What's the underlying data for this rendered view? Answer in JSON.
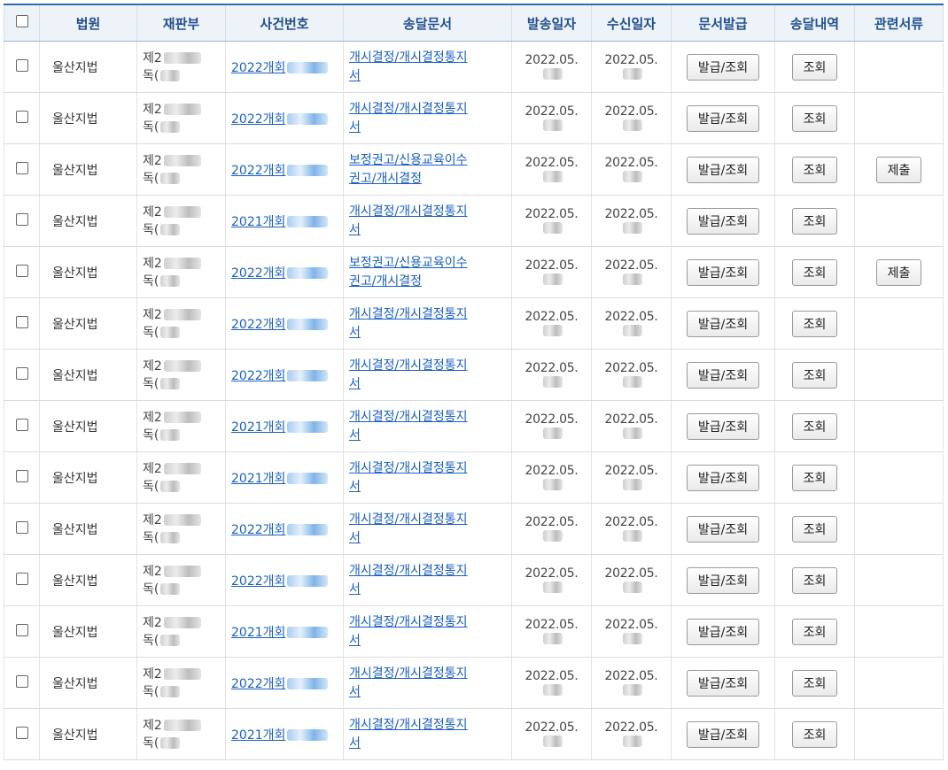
{
  "header": {
    "col_court": "법원",
    "col_dept": "재판부",
    "col_case": "사건번호",
    "col_doc": "송달문서",
    "col_sent": "발송일자",
    "col_recv": "수신일자",
    "col_issue": "문서발급",
    "col_delivery": "송달내역",
    "col_related": "관련서류"
  },
  "rows": [
    {
      "court": "울산지법",
      "dept1": "제2",
      "dept2": "독(",
      "case": "2022개회",
      "doc1": "개시결정/개시결정통지",
      "doc2": "서",
      "sent": "2022.05.",
      "recv": "2022.05.",
      "issue": "발급/조회",
      "delivery": "조회",
      "related": ""
    },
    {
      "court": "울산지법",
      "dept1": "제2",
      "dept2": "독(",
      "case": "2022개회",
      "doc1": "개시결정/개시결정통지",
      "doc2": "서",
      "sent": "2022.05.",
      "recv": "2022.05.",
      "issue": "발급/조회",
      "delivery": "조회",
      "related": ""
    },
    {
      "court": "울산지법",
      "dept1": "제2",
      "dept2": "독(",
      "case": "2022개회",
      "doc1": "보정권고/신용교육이수",
      "doc2": "권고/개시결정",
      "sent": "2022.05.",
      "recv": "2022.05.",
      "issue": "발급/조회",
      "delivery": "조회",
      "related": "제출"
    },
    {
      "court": "울산지법",
      "dept1": "제2",
      "dept2": "독(",
      "case": "2021개회",
      "doc1": "개시결정/개시결정통지",
      "doc2": "서",
      "sent": "2022.05.",
      "recv": "2022.05.",
      "issue": "발급/조회",
      "delivery": "조회",
      "related": ""
    },
    {
      "court": "울산지법",
      "dept1": "제2",
      "dept2": "독(",
      "case": "2022개회",
      "doc1": "보정권고/신용교육이수",
      "doc2": "권고/개시결정",
      "sent": "2022.05.",
      "recv": "2022.05.",
      "issue": "발급/조회",
      "delivery": "조회",
      "related": "제출"
    },
    {
      "court": "울산지법",
      "dept1": "제2",
      "dept2": "독(",
      "case": "2022개회",
      "doc1": "개시결정/개시결정통지",
      "doc2": "서",
      "sent": "2022.05.",
      "recv": "2022.05.",
      "issue": "발급/조회",
      "delivery": "조회",
      "related": ""
    },
    {
      "court": "울산지법",
      "dept1": "제2",
      "dept2": "독(",
      "case": "2022개회",
      "doc1": "개시결정/개시결정통지",
      "doc2": "서",
      "sent": "2022.05.",
      "recv": "2022.05.",
      "issue": "발급/조회",
      "delivery": "조회",
      "related": ""
    },
    {
      "court": "울산지법",
      "dept1": "제2",
      "dept2": "독(",
      "case": "2021개회",
      "doc1": "개시결정/개시결정통지",
      "doc2": "서",
      "sent": "2022.05.",
      "recv": "2022.05.",
      "issue": "발급/조회",
      "delivery": "조회",
      "related": ""
    },
    {
      "court": "울산지법",
      "dept1": "제2",
      "dept2": "독(",
      "case": "2021개회",
      "doc1": "개시결정/개시결정통지",
      "doc2": "서",
      "sent": "2022.05.",
      "recv": "2022.05.",
      "issue": "발급/조회",
      "delivery": "조회",
      "related": ""
    },
    {
      "court": "울산지법",
      "dept1": "제2",
      "dept2": "독(",
      "case": "2022개회",
      "doc1": "개시결정/개시결정통지",
      "doc2": "서",
      "sent": "2022.05.",
      "recv": "2022.05.",
      "issue": "발급/조회",
      "delivery": "조회",
      "related": ""
    },
    {
      "court": "울산지법",
      "dept1": "제2",
      "dept2": "독(",
      "case": "2022개회",
      "doc1": "개시결정/개시결정통지",
      "doc2": "서",
      "sent": "2022.05.",
      "recv": "2022.05.",
      "issue": "발급/조회",
      "delivery": "조회",
      "related": ""
    },
    {
      "court": "울산지법",
      "dept1": "제2",
      "dept2": "독(",
      "case": "2021개회",
      "doc1": "개시결정/개시결정통지",
      "doc2": "서",
      "sent": "2022.05.",
      "recv": "2022.05.",
      "issue": "발급/조회",
      "delivery": "조회",
      "related": ""
    },
    {
      "court": "울산지법",
      "dept1": "제2",
      "dept2": "독(",
      "case": "2022개회",
      "doc1": "개시결정/개시결정통지",
      "doc2": "서",
      "sent": "2022.05.",
      "recv": "2022.05.",
      "issue": "발급/조회",
      "delivery": "조회",
      "related": ""
    },
    {
      "court": "울산지법",
      "dept1": "제2",
      "dept2": "독(",
      "case": "2021개회",
      "doc1": "개시결정/개시결정통지",
      "doc2": "서",
      "sent": "2022.05.",
      "recv": "2022.05.",
      "issue": "발급/조회",
      "delivery": "조회",
      "related": ""
    }
  ]
}
